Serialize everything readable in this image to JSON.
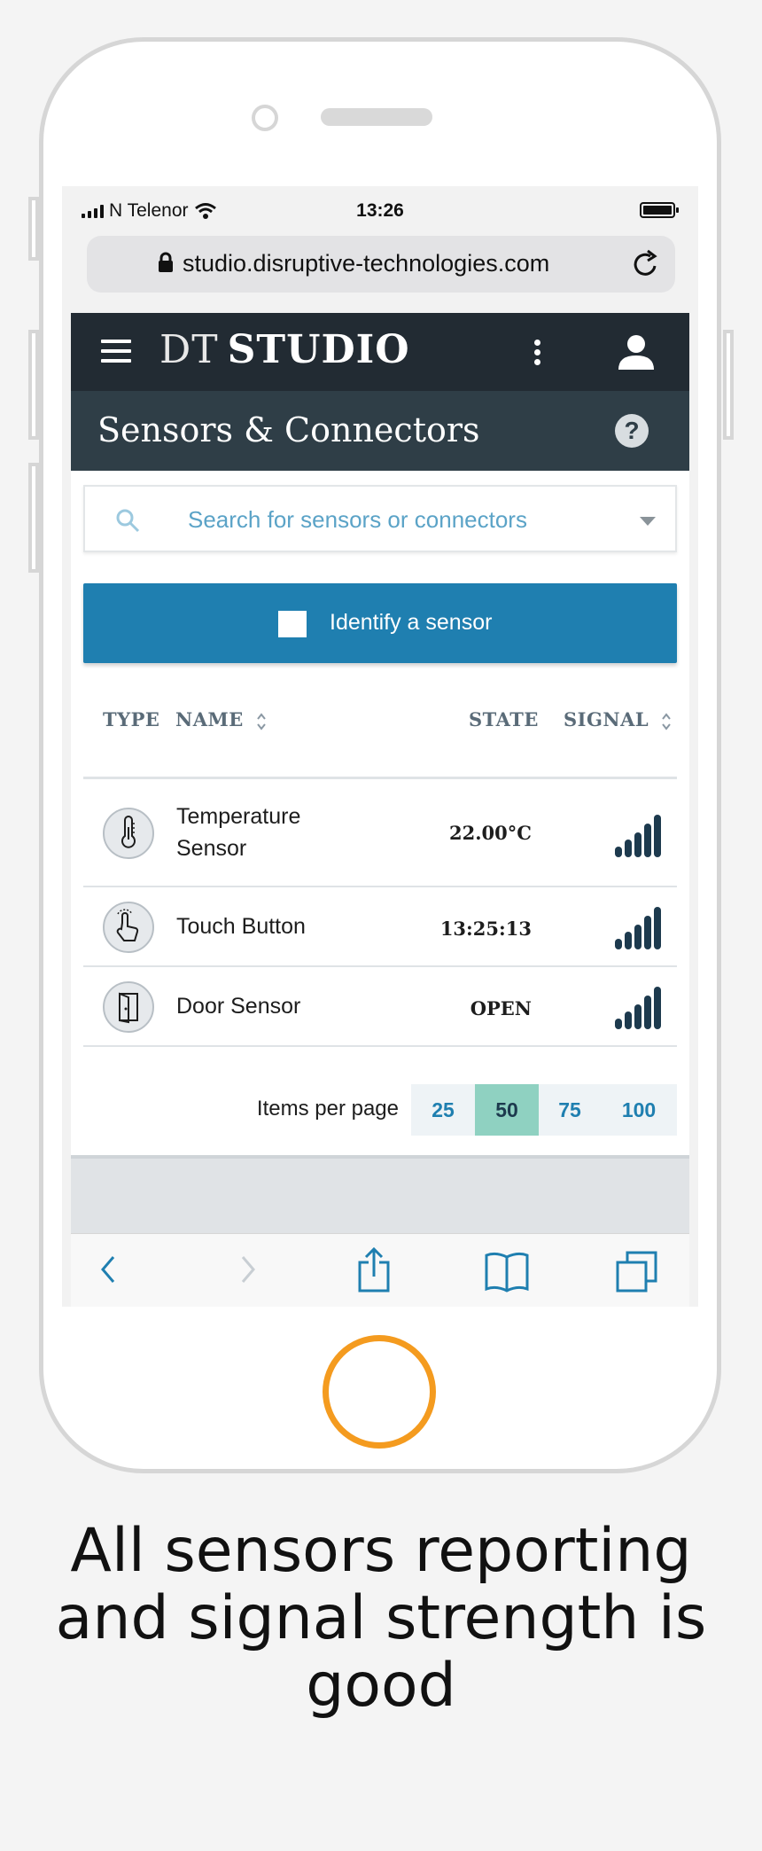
{
  "status_bar": {
    "carrier": "N Telenor",
    "time": "13:26"
  },
  "browser": {
    "url": "studio.disruptive-technologies.com"
  },
  "app": {
    "brand_light": "DT",
    "brand_bold": "STUDIO",
    "page_title": "Sensors & Connectors",
    "help_label": "?",
    "search_placeholder": "Search for sensors or connectors",
    "identify_label": "Identify a sensor",
    "columns": {
      "type": "TYPE",
      "name": "NAME",
      "state": "STATE",
      "signal": "SIGNAL"
    },
    "rows": [
      {
        "icon": "thermometer-icon",
        "name": "Temperature Sensor",
        "state": "22.00°C",
        "signal_bars": 5
      },
      {
        "icon": "touch-hand-icon",
        "name": "Touch Button",
        "state": "13:25:13",
        "signal_bars": 5
      },
      {
        "icon": "door-icon",
        "name": "Door Sensor",
        "state": "OPEN",
        "signal_bars": 5
      }
    ],
    "pagination": {
      "label": "Items per page",
      "options": [
        "25",
        "50",
        "75",
        "100"
      ],
      "selected": "50"
    }
  },
  "colors": {
    "topbar": "#222b33",
    "subbar": "#2f3e47",
    "accent": "#1f7fb0",
    "active_page": "#8fd1c1",
    "home_button": "#f49b1f"
  },
  "caption": "All sensors reporting and signal strength is good"
}
